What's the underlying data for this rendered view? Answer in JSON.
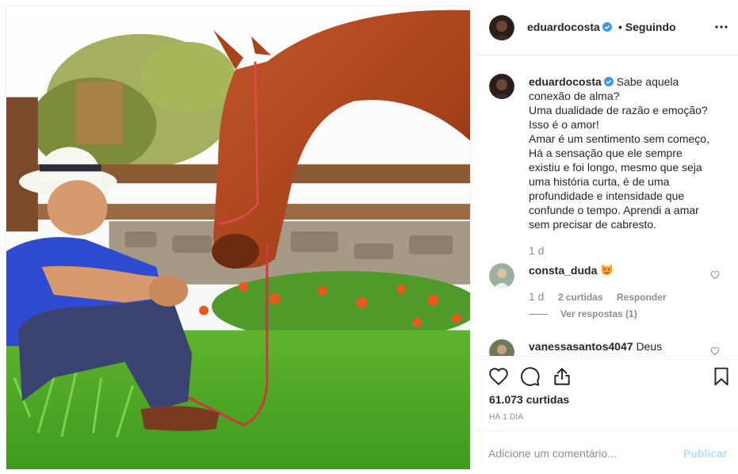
{
  "post": {
    "username": "eduardocosta",
    "follow_state": "• Seguindo",
    "caption_lines": [
      "Sabe aquela",
      "conexão de alma?",
      "Uma dualidade de razão e emoção?",
      "Isso é o amor!",
      "Amar é um sentimento sem começo,",
      "Há a sensação que ele sempre",
      "existiu e foi longo, mesmo que seja",
      "uma história curta, é de uma",
      "profundidade e intensidade que",
      "confunde o tempo. Aprendi a amar",
      "sem precisar de cabresto."
    ],
    "caption_time": "1 d"
  },
  "comments": [
    {
      "username": "consta_duda",
      "emoji": "heart-eyes-cat-emoji",
      "time": "1 d",
      "likes": "2 curtidas",
      "reply": "Responder",
      "view_replies": "Ver respostas (1)"
    },
    {
      "username": "vanessasantos4047",
      "text": "Deus"
    }
  ],
  "actions": {
    "likes": "61.073 curtidas",
    "posted": "HÁ 1 DIA"
  },
  "add_comment": {
    "placeholder": "Adicione um comentário...",
    "publish": "Publicar"
  },
  "colors": {
    "verified": "#3897f0",
    "muted": "#8e8e8e",
    "publish_disabled": "#b2dffc"
  }
}
